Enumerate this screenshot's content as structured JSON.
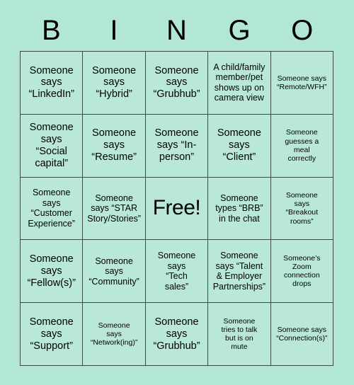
{
  "card": {
    "title": "BINGO",
    "background_color": "#b2e6d6",
    "cell_color": "#b9e8d9",
    "border_color": "#3a4a44",
    "text_color": "#000000"
  },
  "header": {
    "letters": [
      "B",
      "I",
      "N",
      "G",
      "O"
    ]
  },
  "grid": {
    "rows": 5,
    "columns": 5,
    "cells": [
      {
        "text": "Someone\nsays\n“LinkedIn”",
        "size": "lg",
        "free": false
      },
      {
        "text": "Someone\nsays\n“Hybrid”",
        "size": "lg",
        "free": false
      },
      {
        "text": "Someone\nsays\n“Grubhub”",
        "size": "lg",
        "free": false
      },
      {
        "text": "A child/family\nmember/pet\nshows up on\ncamera view",
        "size": "md",
        "free": false
      },
      {
        "text": "Someone says\n“Remote/WFH”",
        "size": "sm",
        "free": false
      },
      {
        "text": "Someone\nsays\n“Social\ncapital”",
        "size": "lg",
        "free": false
      },
      {
        "text": "Someone\nsays\n“Resume”",
        "size": "lg",
        "free": false
      },
      {
        "text": "Someone\nsays “In-\nperson”",
        "size": "lg",
        "free": false
      },
      {
        "text": "Someone\nsays\n“Client”",
        "size": "lg",
        "free": false
      },
      {
        "text": "Someone\nguesses a\nmeal\ncorrectly",
        "size": "sm",
        "free": false
      },
      {
        "text": "Someone\nsays\n“Customer\nExperience”",
        "size": "md",
        "free": false
      },
      {
        "text": "Someone\nsays “STAR\nStory/Stories”",
        "size": "md",
        "free": false
      },
      {
        "text": "Free!",
        "size": "free",
        "free": true
      },
      {
        "text": "Someone\ntypes “BRB”\nin the chat",
        "size": "md",
        "free": false
      },
      {
        "text": "Someone\nsays\n“Breakout\nrooms”",
        "size": "sm",
        "free": false
      },
      {
        "text": "Someone\nsays\n“Fellow(s)”",
        "size": "lg",
        "free": false
      },
      {
        "text": "Someone\nsays\n“Community”",
        "size": "md",
        "free": false
      },
      {
        "text": "Someone\nsays\n“Tech\nsales”",
        "size": "md",
        "free": false
      },
      {
        "text": "Someone\nsays “Talent\n& Employer\nPartnerships”",
        "size": "md",
        "free": false
      },
      {
        "text": "Someone’s\nZoom\nconnection\ndrops",
        "size": "sm",
        "free": false
      },
      {
        "text": "Someone\nsays\n“Support”",
        "size": "lg",
        "free": false
      },
      {
        "text": "Someone\nsays\n“Network(ing)”",
        "size": "sm",
        "free": false
      },
      {
        "text": "Someone\nsays\n“Grubhub”",
        "size": "lg",
        "free": false
      },
      {
        "text": "Someone\ntries to talk\nbut is on\nmute",
        "size": "sm",
        "free": false
      },
      {
        "text": "Someone says\n“Connection(s)”",
        "size": "sm",
        "free": false
      }
    ]
  }
}
